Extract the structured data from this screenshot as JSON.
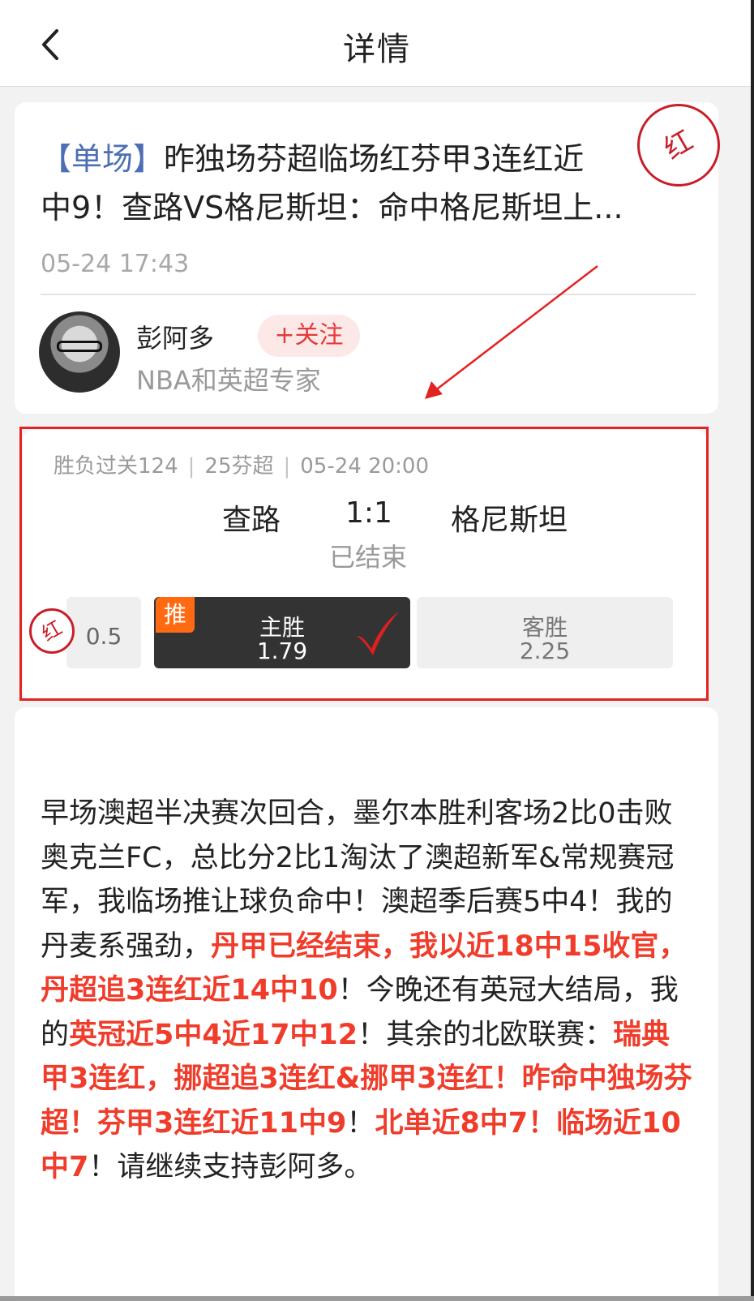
{
  "header": {
    "title": "详情",
    "back_icon": "chevron-left-icon"
  },
  "post": {
    "tag": "【单场】",
    "title_line1": "昨独场芬超临场红芬甲3连红近",
    "title_line2": "中9！查路VS格尼斯坦：命中格尼斯坦上...",
    "time": "05-24 17:43",
    "author": {
      "name": "彭阿多",
      "title": "NBA和英超专家",
      "follow_label": "+关注"
    },
    "stamp": "红"
  },
  "match": {
    "lottery": "胜负过关124",
    "league": "25芬超",
    "kickoff": "05-24 20:00",
    "home": "查路",
    "score": "1:1",
    "away": "格尼斯坦",
    "status": "已结束",
    "handicap_stamp": "红",
    "handicap": "0.5",
    "options": [
      {
        "label": "主胜",
        "odds": "1.79",
        "badge": "推",
        "recommended": true,
        "hit": true
      },
      {
        "label": "客胜",
        "odds": "2.25"
      }
    ]
  },
  "article": {
    "segments": [
      {
        "text": "早场澳超半决赛次回合，墨尔本胜利客场2比0击败奥克兰FC，总比分2比1淘汰了澳超新军&常规赛冠军，我临场推让球负命中！澳超季后赛5中4！我的丹麦系强劲，",
        "highlight": false
      },
      {
        "text": "丹甲已经结束，我以近18中15收官，丹超追3连红近14中10",
        "highlight": true
      },
      {
        "text": "！今晚还有英冠大结局，我的",
        "highlight": false
      },
      {
        "text": "英冠近5中4近17中12",
        "highlight": true
      },
      {
        "text": "！其余的北欧联赛：",
        "highlight": false
      },
      {
        "text": "瑞典甲3连红，挪超追3连红&挪甲3连红！昨命中独场芬超！芬甲3连红近11中9",
        "highlight": true
      },
      {
        "text": "！",
        "highlight": false
      },
      {
        "text": "北单近8中7！临场近10中7",
        "highlight": true
      },
      {
        "text": "！请继续支持彭阿多。",
        "highlight": false
      }
    ]
  },
  "colors": {
    "accent_red": "#f03c2b",
    "tag_blue": "#4c6fb5",
    "badge_orange": "#ff6a13",
    "stamp_red": "#c81e28"
  }
}
